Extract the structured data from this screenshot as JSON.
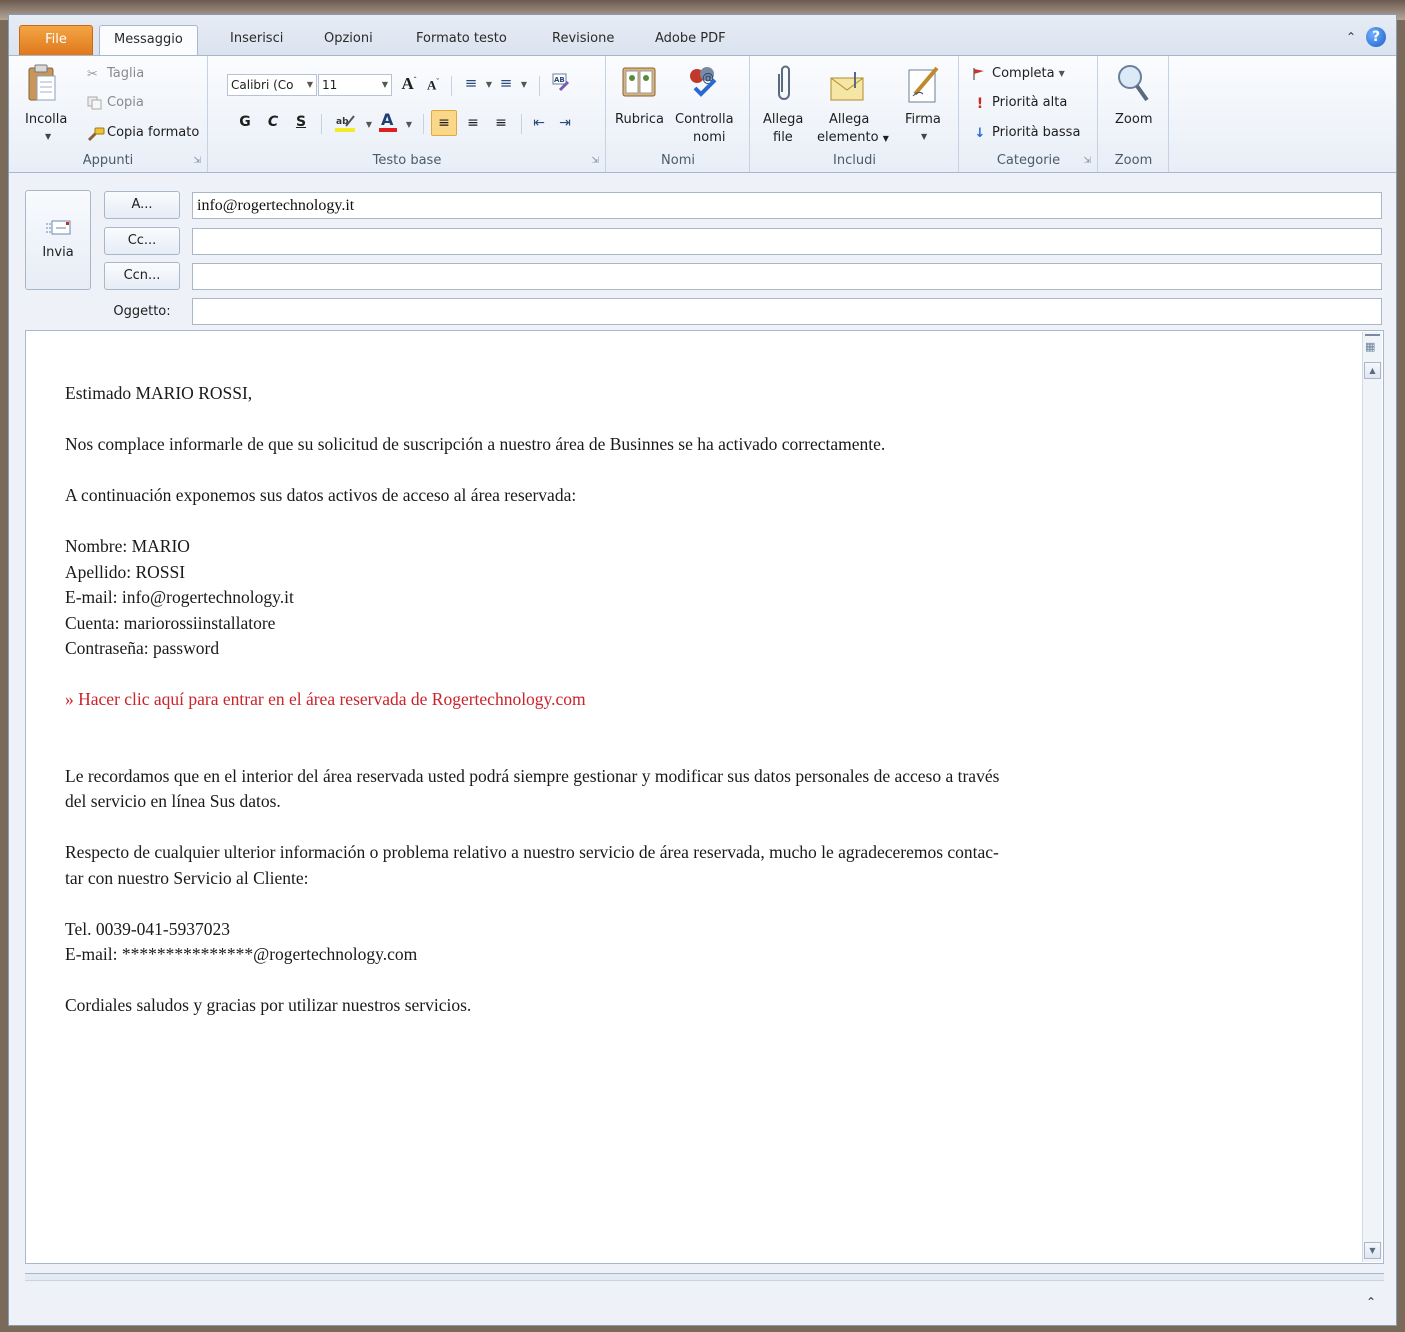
{
  "tabs": {
    "file": "File",
    "messaggio": "Messaggio",
    "inserisci": "Inserisci",
    "opzioni": "Opzioni",
    "formato_testo": "Formato testo",
    "revisione": "Revisione",
    "adobe_pdf": "Adobe PDF"
  },
  "ribbon": {
    "appunti": {
      "label": "Appunti",
      "incolla": "Incolla",
      "taglia": "Taglia",
      "copia": "Copia",
      "copia_formato": "Copia formato"
    },
    "testo_base": {
      "label": "Testo base",
      "font_name": "Calibri (Co",
      "font_size": "11",
      "bold": "G",
      "italic": "C",
      "underline": "S"
    },
    "nomi": {
      "label": "Nomi",
      "rubrica": "Rubrica",
      "controlla_1": "Controlla",
      "controlla_2": "nomi"
    },
    "includi": {
      "label": "Includi",
      "allega_file_1": "Allega",
      "allega_file_2": "file",
      "allega_elemento_1": "Allega",
      "allega_elemento_2": "elemento",
      "firma": "Firma"
    },
    "categorie": {
      "label": "Categorie",
      "completa": "Completa",
      "priorita_alta": "Priorità alta",
      "priorita_bassa": "Priorità bassa"
    },
    "zoom": {
      "label": "Zoom",
      "zoom_btn": "Zoom"
    }
  },
  "header": {
    "send": "Invia",
    "to_button": "A...",
    "cc_button": "Cc...",
    "bcc_button": "Ccn...",
    "subject_label": "Oggetto:",
    "to_value": "info@rogertechnology.it",
    "cc_value": "",
    "bcc_value": "",
    "subject_value": ""
  },
  "message": {
    "greeting": "Estimado MARIO ROSSI,",
    "p1": "Nos complace informarle de que su solicitud de suscripción a nuestro área de Businnes se ha activado correctamente.",
    "p2": "A continuación exponemos sus datos activos de acceso al área reservada:",
    "nombre": "Nombre: MARIO",
    "apellido": "Apellido: ROSSI",
    "email": "E-mail: info@rogertechnology.it",
    "cuenta": "Cuenta: mariorossiinstallatore",
    "contrasena": "Contraseña: password",
    "link": "» Hacer clic aquí para entrar en el área reservada de Rogertechnology.com",
    "p3_line1": "Le recordamos que en el interior del área reservada usted podrá siempre gestionar y modificar sus datos personales de acceso a través",
    "p3_line2": "del servicio en línea Sus datos.",
    "p4_line1": "Respecto de cualquier ulterior información o problema relativo a nuestro servicio de área reservada, mucho le agradeceremos contac-",
    "p4_line2": "tar con nuestro Servicio al Cliente:",
    "tel": "Tel. 0039-041-5937023",
    "email2": "E-mail: ***************@rogertechnology.com",
    "closing": "Cordiales saludos y gracias por utilizar nuestros servicios."
  },
  "colors": {
    "file_tab": "#e0781b",
    "link": "#cc2229",
    "help": "#1d5fc8"
  }
}
